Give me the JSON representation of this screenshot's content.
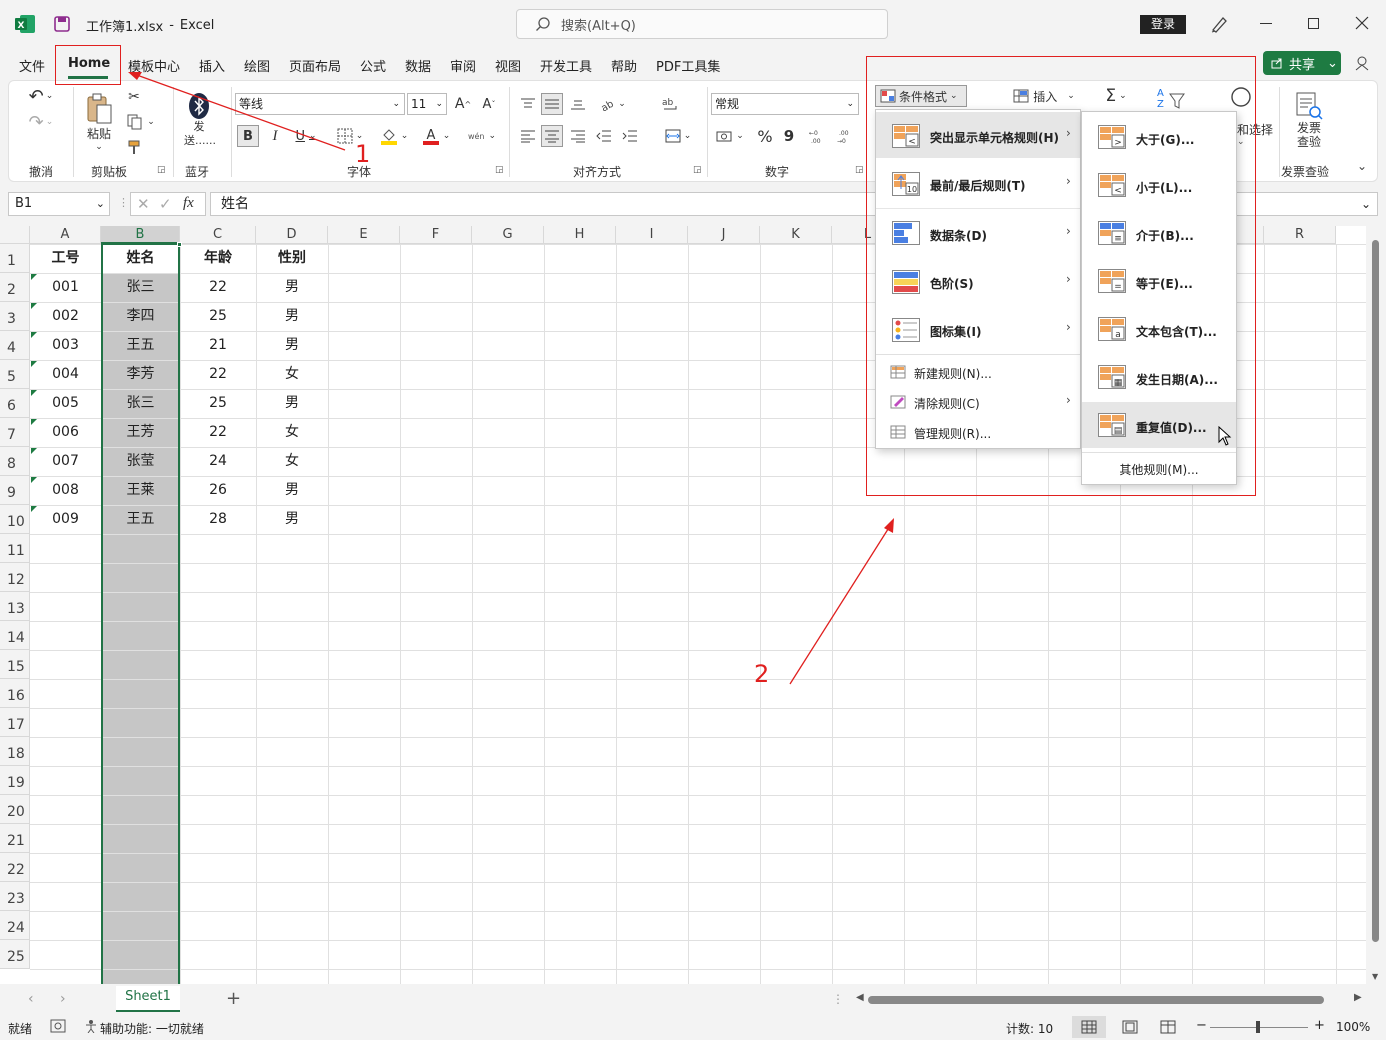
{
  "titlebar": {
    "filename": "工作簿1.xlsx",
    "separator": "-",
    "app": "Excel",
    "search_placeholder": "搜索(Alt+Q)",
    "login": "登录"
  },
  "tabs": [
    "文件",
    "Home",
    "模板中心",
    "插入",
    "绘图",
    "页面布局",
    "公式",
    "数据",
    "审阅",
    "视图",
    "开发工具",
    "帮助",
    "PDF工具集"
  ],
  "share": "共享",
  "ribbon": {
    "undo_group": "撤消",
    "clipboard": {
      "paste": "粘贴",
      "group": "剪贴板"
    },
    "bluetooth": {
      "send": "发送......",
      "group": "蓝牙"
    },
    "font": {
      "name": "等线",
      "size": "11",
      "grow": "A^",
      "shrink": "A˅",
      "bold": "B",
      "italic": "I",
      "underline": "U",
      "phonetic": "wén",
      "group": "字体"
    },
    "alignment": {
      "group": "对齐方式"
    },
    "number": {
      "format": "常规",
      "percent": "%",
      "comma": "9",
      "group": "数字"
    },
    "cond_format": "条件格式",
    "insert": "插入",
    "sigma": "Σ",
    "sort_label": "A Z",
    "find_label": "和选择",
    "invoice": {
      "label1": "发票",
      "label2": "查验",
      "group": "发票查验"
    }
  },
  "formula": {
    "namebox": "B1",
    "fx": "fx",
    "value": "姓名"
  },
  "grid": {
    "columns": [
      "A",
      "B",
      "C",
      "D",
      "E",
      "F",
      "G",
      "H",
      "I",
      "J",
      "K",
      "L",
      "M",
      "N",
      "O",
      "P",
      "Q",
      "R"
    ],
    "rows": [
      "1",
      "2",
      "3",
      "4",
      "5",
      "6",
      "7",
      "8",
      "9",
      "10",
      "11",
      "12",
      "13",
      "14",
      "15",
      "16",
      "17",
      "18",
      "19",
      "20",
      "21",
      "22",
      "23",
      "24",
      "25"
    ],
    "headers": [
      "工号",
      "姓名",
      "年龄",
      "性别"
    ],
    "data": [
      [
        "001",
        "张三",
        "22",
        "男"
      ],
      [
        "002",
        "李四",
        "25",
        "男"
      ],
      [
        "003",
        "王五",
        "21",
        "男"
      ],
      [
        "004",
        "李芳",
        "22",
        "女"
      ],
      [
        "005",
        "张三",
        "25",
        "男"
      ],
      [
        "006",
        "王芳",
        "22",
        "女"
      ],
      [
        "007",
        "张莹",
        "24",
        "女"
      ],
      [
        "008",
        "王莱",
        "26",
        "男"
      ],
      [
        "009",
        "王五",
        "28",
        "男"
      ]
    ]
  },
  "cf_menu": {
    "items": [
      {
        "label": "突出显示单元格规则(H)",
        "bold": true
      },
      {
        "label": "最前/最后规则(T)",
        "bold": true
      },
      {
        "label": "数据条(D)",
        "bold": true
      },
      {
        "label": "色阶(S)",
        "bold": true
      },
      {
        "label": "图标集(I)",
        "bold": true
      }
    ],
    "small_items": [
      "新建规则(N)...",
      "清除规则(C)",
      "管理规则(R)..."
    ],
    "icon_digits": "10"
  },
  "sub_menu": {
    "items": [
      "大于(G)...",
      "小于(L)...",
      "介于(B)...",
      "等于(E)...",
      "文本包含(T)...",
      "发生日期(A)...",
      "重复值(D)..."
    ],
    "other": "其他规则(M)..."
  },
  "annotations": {
    "one": "1",
    "two": "2",
    "color": "#e0201f"
  },
  "sheet": {
    "name": "Sheet1",
    "add": "+"
  },
  "status": {
    "ready": "就绪",
    "accessibility": "辅助功能: 一切就绪",
    "count": "计数: 10",
    "zoom": "100%"
  },
  "colors": {
    "excel_green": "#217346",
    "share_green": "#1e7b42",
    "selection_gray": "#c6c6c6",
    "red_box": "#e0201f"
  }
}
